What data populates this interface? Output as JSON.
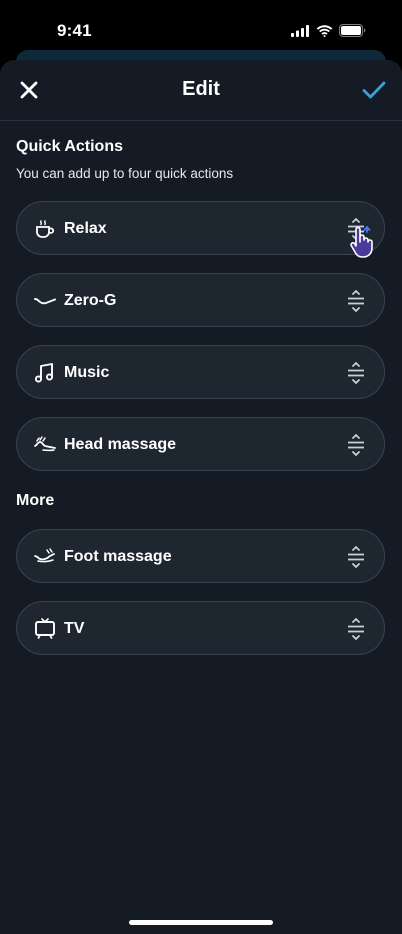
{
  "status_bar": {
    "time": "9:41"
  },
  "nav": {
    "title": "Edit",
    "close_icon": "close-icon",
    "confirm_icon": "checkmark-icon",
    "accent_color": "#3aa0d8"
  },
  "quick_actions": {
    "title": "Quick Actions",
    "subtitle": "You can add up to four quick actions",
    "items": [
      {
        "label": "Relax",
        "icon": "coffee-cup-icon"
      },
      {
        "label": "Zero-G",
        "icon": "zero-gravity-icon"
      },
      {
        "label": "Music",
        "icon": "music-note-icon"
      },
      {
        "label": "Head massage",
        "icon": "head-massage-icon"
      }
    ]
  },
  "more": {
    "title": "More",
    "items": [
      {
        "label": "Foot massage",
        "icon": "foot-massage-icon"
      },
      {
        "label": "TV",
        "icon": "tv-icon"
      }
    ]
  }
}
